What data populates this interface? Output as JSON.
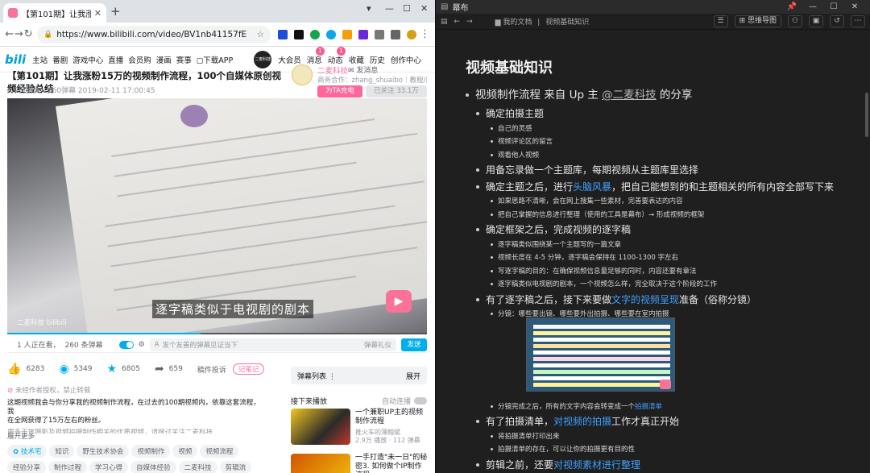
{
  "browser": {
    "tab_title": "【第101期】让我涨粉15万的视频制...",
    "url": "https://www.bilibili.com/video/BV1nb41157fE"
  },
  "bili_nav": {
    "items": [
      "主站",
      "番剧",
      "游戏中心",
      "直播",
      "会员购",
      "漫画",
      "赛事",
      "下载APP"
    ],
    "avatar_text": "二麦科技",
    "right_items": [
      {
        "label": "大会员",
        "badge": ""
      },
      {
        "label": "消息",
        "badge": "1"
      },
      {
        "label": "动态",
        "badge": "1"
      },
      {
        "label": "收藏",
        "badge": ""
      },
      {
        "label": "历史",
        "badge": ""
      },
      {
        "label": "创作中心",
        "badge": ""
      }
    ]
  },
  "video": {
    "title": "【第101期】让我涨粉15万的视频制作流程，100个自媒体原创视频经验总结",
    "meta": "8.7万播放 · 260弹幕   2019-02-11 17:00:45",
    "subtitle": "逐字稿类似于电视剧的剧本",
    "watermark": "二麦科技 bilibili"
  },
  "uploader": {
    "name": "二麦科技",
    "message": "发消息",
    "coop": "商务合作：zhang_shuaibo｜教程/器...",
    "charge": "为TA充电",
    "follow": "已关注 33.1万"
  },
  "danmaku": {
    "online": "1 人正在看，",
    "count": "260 条弹幕",
    "placeholder": "发个友善的弹幕见证当下",
    "etiquette": "弹幕礼仪",
    "send": "发送"
  },
  "actions": {
    "like": "6283",
    "coin": "5349",
    "fav": "6805",
    "share": "659",
    "report": "稿件投诉",
    "note": "记笔记"
  },
  "copyright": "未经作者授权，禁止转载",
  "description": {
    "line1": "这期视频我会与你分享我的视频制作流程，在过去的100期视频内，依靠这套流程，我",
    "line2": "在全网获得了15万左右的粉丝。",
    "line3": "更多干货摄影及视频拍摄制作相关的优质视频，请搜过关注二麦科技",
    "more": "展开更多"
  },
  "tags": [
    "技术宅",
    "知识",
    "野生技术协会",
    "视频制作",
    "视频",
    "视频流程",
    "经验分享",
    "制作过程",
    "学习心得",
    "自媒体经验",
    "二麦科技",
    "剪辑流"
  ],
  "side": {
    "danmaku_list": "弹幕列表",
    "expand": "展开",
    "next_label": "接下来播放",
    "autoplay": "自动连播",
    "recs": [
      {
        "title": "一个兼职UP主的视频制作流程",
        "author": "推火车的薄翰斌",
        "views": "2.9万 播放 · 112 弹幕"
      },
      {
        "title": "一手打造\"未一日\"的秘密3. 如何做个IP制作流程",
        "author": "",
        "views": ""
      }
    ]
  },
  "mubu": {
    "app_title": "幕布",
    "breadcrumb_root": "我的文档",
    "breadcrumb_doc": "视频基础知识",
    "mindmap": "思维导图",
    "doc_title": "视频基础知识",
    "outline": [
      {
        "level": 0,
        "parts": [
          {
            "t": "视频制作流程 来自 Up 主 "
          },
          {
            "t": "@二麦科技",
            "cls": "ul"
          },
          {
            "t": " 的分享"
          }
        ]
      },
      {
        "level": 1,
        "parts": [
          {
            "t": "确定拍摄主题"
          }
        ]
      },
      {
        "level": 2,
        "parts": [
          {
            "t": "自己的灵感"
          }
        ]
      },
      {
        "level": 2,
        "parts": [
          {
            "t": "视频评论区的留言"
          }
        ]
      },
      {
        "level": 2,
        "parts": [
          {
            "t": "观看他人视频"
          }
        ]
      },
      {
        "level": 1,
        "parts": [
          {
            "t": "用备忘录做一个主题库，每期视频从主题库里选择"
          }
        ]
      },
      {
        "level": 1,
        "parts": [
          {
            "t": "确定主题之后，进行"
          },
          {
            "t": "头脑风暴",
            "cls": "lnk"
          },
          {
            "t": "，把自己能想到的和主题相关的所有内容全部写下来"
          }
        ]
      },
      {
        "level": 2,
        "parts": [
          {
            "t": "如果思路不清晰，会在网上搜集一些素材，完善要表达的内容"
          }
        ]
      },
      {
        "level": 2,
        "parts": [
          {
            "t": "把自己掌握的信息进行整理（使用的工具是幕布）→ 形成视频的框架"
          }
        ]
      },
      {
        "level": 1,
        "parts": [
          {
            "t": "确定框架之后，完成视频的逐字稿"
          }
        ]
      },
      {
        "level": 2,
        "parts": [
          {
            "t": "逐字稿类似围绕某一个主题写的一篇文章"
          }
        ]
      },
      {
        "level": 2,
        "parts": [
          {
            "t": "视频长度在 4-5 分钟，逐字稿会保持在 1100-1300 字左右"
          }
        ]
      },
      {
        "level": 2,
        "parts": [
          {
            "t": "写逐字稿的目的：在确保视频信息量足够的同时，内容还要有章法"
          }
        ]
      },
      {
        "level": 2,
        "parts": [
          {
            "t": "逐字稿类似电视剧的剧本，一个视频怎么样，完全取决于这个阶段的工作"
          }
        ]
      },
      {
        "level": 1,
        "parts": [
          {
            "t": "有了逐字稿之后，接下来要做"
          },
          {
            "t": "文字的视频呈现",
            "cls": "lnk"
          },
          {
            "t": "准备（俗称分镜）"
          }
        ]
      },
      {
        "level": 2,
        "parts": [
          {
            "t": "分镜：哪些要出镜、哪些要外出拍摄、哪些要在室内拍摄"
          }
        ]
      },
      {
        "level": 2,
        "parts": [
          {
            "t": "分镜完成之后，所有的文字内容会转变成一个"
          },
          {
            "t": "拍摄清单",
            "cls": "lnk"
          }
        ]
      },
      {
        "level": 1,
        "parts": [
          {
            "t": "有了拍摄清单，"
          },
          {
            "t": "对视频的拍摄",
            "cls": "lnk"
          },
          {
            "t": "工作才真正开始"
          }
        ]
      },
      {
        "level": 2,
        "parts": [
          {
            "t": "将拍摄清单打印出来"
          }
        ]
      },
      {
        "level": 2,
        "parts": [
          {
            "t": "拍摄清单的存在，可以让你的拍摄更有目的性"
          }
        ]
      },
      {
        "level": 1,
        "parts": [
          {
            "t": "剪辑之前，还要"
          },
          {
            "t": "对视频素材进行整理",
            "cls": "lnk"
          }
        ]
      },
      {
        "level": 2,
        "parts": [
          {
            "t": "将素材进行重命名，将镜头按照序号进行标记"
          }
        ]
      }
    ]
  },
  "colors": {
    "bili_pink": "#fb7299",
    "bili_blue": "#00aeec",
    "mubu_bg": "#1f1f1f",
    "mubu_link": "#3fa0ff"
  }
}
